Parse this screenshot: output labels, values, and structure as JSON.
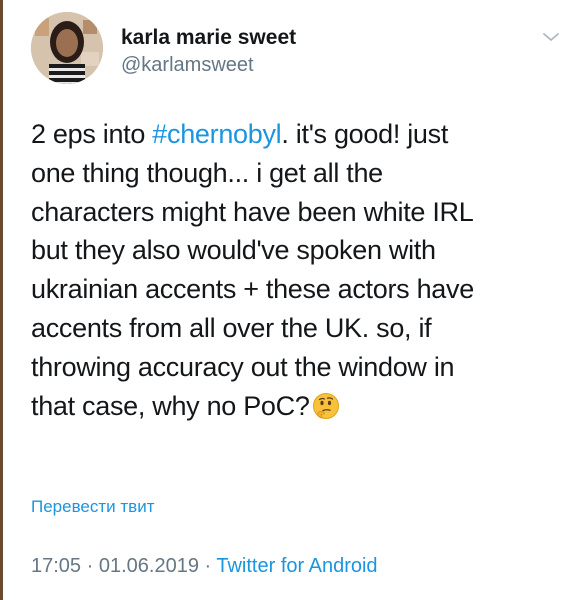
{
  "user": {
    "display_name": "karla marie sweet",
    "handle": "@karlamsweet"
  },
  "tweet": {
    "line1_pre": "2 eps into ",
    "hashtag": "#chernobyl",
    "line1_post": ". it's good! just",
    "line2": "one thing though... i get all the",
    "line3": "characters might have been white IRL",
    "line4": "but they also would've spoken with",
    "line5": "ukrainian accents + these actors have",
    "line6": "accents from all over the UK. so, if",
    "line7": "throwing accuracy out the window in",
    "line8": "that case, why no PoC?",
    "emoji_icon": "thinking-face"
  },
  "translate_label": "Перевести твит",
  "meta": {
    "time": "17:05",
    "separator1": " · ",
    "date": "01.06.2019",
    "separator2": " · ",
    "source": "Twitter for Android"
  },
  "colors": {
    "link": "#1b95e0",
    "secondary": "#657786",
    "text": "#14171a"
  }
}
